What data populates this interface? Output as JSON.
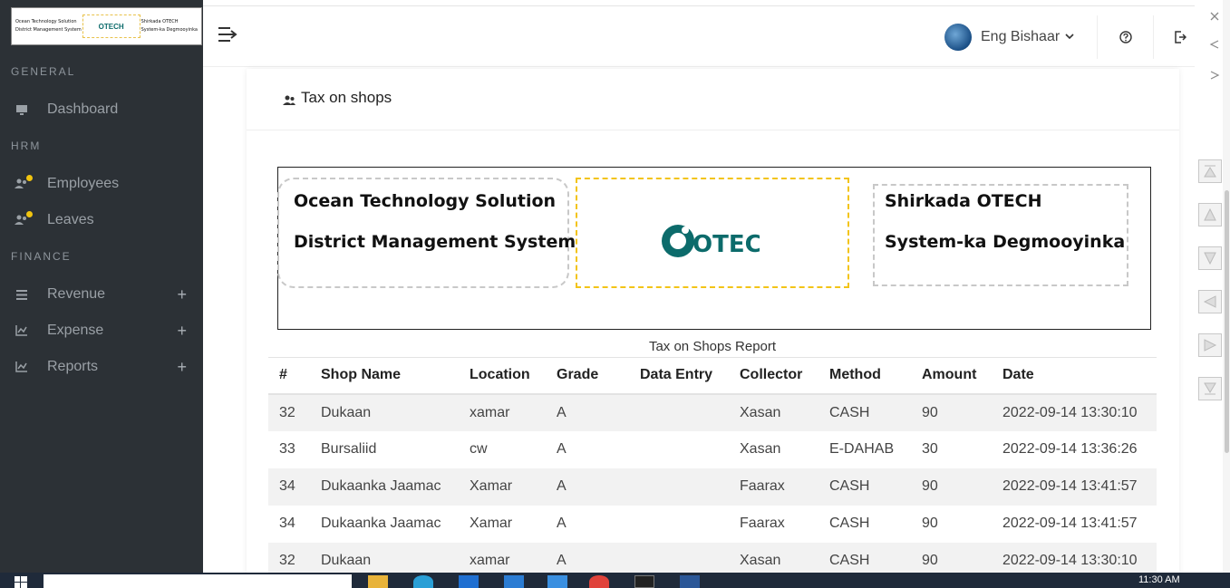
{
  "logo_mini": {
    "left_line1": "Ocean Technology Solution",
    "left_line2": "District Management System",
    "mid": "OTECH",
    "right_line1": "Shirkada OTECH",
    "right_line2": "System-ka Degmooyinka"
  },
  "sidebar": {
    "sections": [
      {
        "label": "GENERAL"
      },
      {
        "label": "HRM"
      },
      {
        "label": "FINANCE"
      }
    ],
    "items": [
      {
        "label": "Dashboard",
        "icon": "monitor-icon"
      },
      {
        "label": "Employees",
        "icon": "users-icon"
      },
      {
        "label": "Leaves",
        "icon": "users-icon"
      },
      {
        "label": "Revenue",
        "icon": "list-icon",
        "plus": "+"
      },
      {
        "label": "Expense",
        "icon": "chart-icon",
        "plus": "+"
      },
      {
        "label": "Reports",
        "icon": "chart-icon",
        "plus": "+"
      }
    ]
  },
  "header": {
    "user_name": "Eng Bishaar",
    "icons": [
      "menu-toggle-icon",
      "help-icon",
      "logout-icon"
    ]
  },
  "card": {
    "title": "Tax on shops"
  },
  "report_header": {
    "left_line1": "Ocean Technology Solution",
    "left_line2": "District Management System",
    "logo_text": "OTECH",
    "right_line1": "Shirkada OTECH",
    "right_line2": "System-ka Degmooyinka"
  },
  "report": {
    "caption": "Tax on Shops Report",
    "columns": [
      "#",
      "Shop Name",
      "Location",
      "Grade",
      "Data Entry",
      "Collector",
      "Method",
      "Amount",
      "Date"
    ],
    "rows": [
      [
        "32",
        "Dukaan",
        "xamar",
        "A",
        "",
        "Xasan",
        "CASH",
        "90",
        "2022-09-14 13:30:10"
      ],
      [
        "33",
        "Bursaliid",
        "cw",
        "A",
        "",
        "Xasan",
        "E-DAHAB",
        "30",
        "2022-09-14 13:36:26"
      ],
      [
        "34",
        "Dukaanka Jaamac",
        "Xamar",
        "A",
        "",
        "Faarax",
        "CASH",
        "90",
        "2022-09-14 13:41:57"
      ],
      [
        "34",
        "Dukaanka Jaamac",
        "Xamar",
        "A",
        "",
        "Faarax",
        "CASH",
        "90",
        "2022-09-14 13:41:57"
      ],
      [
        "32",
        "Dukaan",
        "xamar",
        "A",
        "",
        "Xasan",
        "CASH",
        "90",
        "2022-09-14 13:30:10"
      ]
    ]
  },
  "taskbar": {
    "time": "11:30 AM"
  },
  "colors": {
    "sidebar_bg": "#2c3136",
    "accent_yellow": "#f1c40f",
    "logo_teal": "#0c6b6b"
  }
}
